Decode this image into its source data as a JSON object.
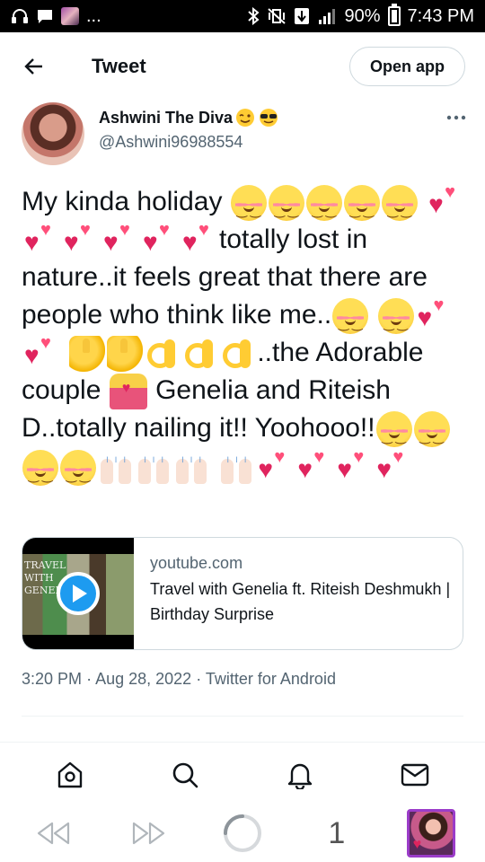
{
  "status_bar": {
    "overflow": "...",
    "battery_percent": "90%",
    "time": "7:43 PM"
  },
  "header": {
    "title": "Tweet",
    "open_app_label": "Open app"
  },
  "author": {
    "name": "Ashwini The Diva",
    "name_emojis": [
      "wink-face",
      "sunglasses-face"
    ],
    "handle": "@Ashwini96988554"
  },
  "tweet": {
    "segments": [
      "My kinda holiday",
      "totally lost in nature..it feels great that there are people who think like me..",
      "..the Adorable couple",
      "Genelia and Riteish D..totally nailing it!! Yoohooo!!"
    ]
  },
  "link_card": {
    "domain": "youtube.com",
    "title": "Travel with Genelia ft. Riteish Deshmukh | Birthday Surprise",
    "thumb_text": "TRAVEL WITH GENELIA"
  },
  "meta": {
    "time": "3:20 PM",
    "date": "Aug 28, 2022",
    "client": "Twitter for Android",
    "separator": "·"
  },
  "bottom_nav": [
    "home-icon",
    "search-icon",
    "notifications-icon",
    "messages-icon"
  ],
  "browser_bar": {
    "tab_count": "1"
  },
  "colors": {
    "link_blue": "#1d9bf0",
    "secondary_text": "#536471",
    "heart_red": "#e0245e",
    "profile_border": "#9b3cc9"
  }
}
